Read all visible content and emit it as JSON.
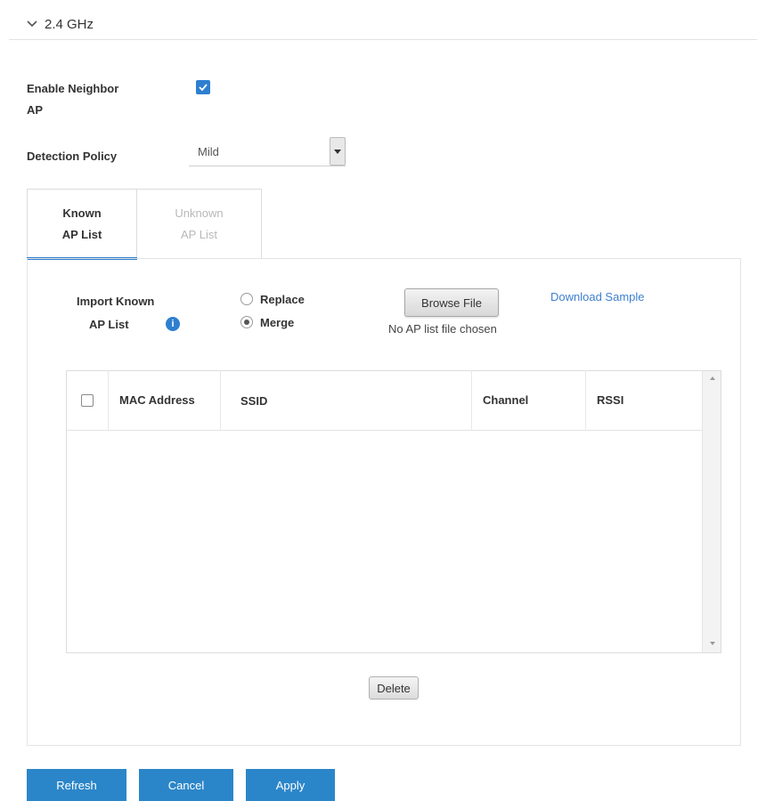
{
  "section": {
    "title": "2.4 GHz",
    "icon": "chevron-down-icon"
  },
  "settings": {
    "enable_neighbor_ap_label_line1": "Enable Neighbor",
    "enable_neighbor_ap_label_line2": "AP",
    "enable_neighbor_ap_checked": true,
    "detection_policy_label": "Detection Policy",
    "detection_policy_value": "Mild"
  },
  "tabs": [
    {
      "line1": "Known",
      "line2": "AP List",
      "active": true
    },
    {
      "line1": "Unknown",
      "line2": "AP List",
      "active": false
    }
  ],
  "import": {
    "label_line1": "Import Known",
    "label_line2": "AP List",
    "info_icon": "info-icon",
    "options": [
      {
        "label": "Replace",
        "selected": false
      },
      {
        "label": "Merge",
        "selected": true
      }
    ],
    "browse_label": "Browse File",
    "file_status": "No AP list file chosen",
    "download_label": "Download Sample"
  },
  "table": {
    "columns": [
      "MAC Address",
      "SSID",
      "Channel",
      "RSSI"
    ],
    "rows": []
  },
  "delete_label": "Delete",
  "actions": {
    "refresh": "Refresh",
    "cancel": "Cancel",
    "apply": "Apply"
  },
  "colors": {
    "accent": "#2e7fd0",
    "button_blue": "#2b86c9",
    "link": "#3d7fcf"
  }
}
